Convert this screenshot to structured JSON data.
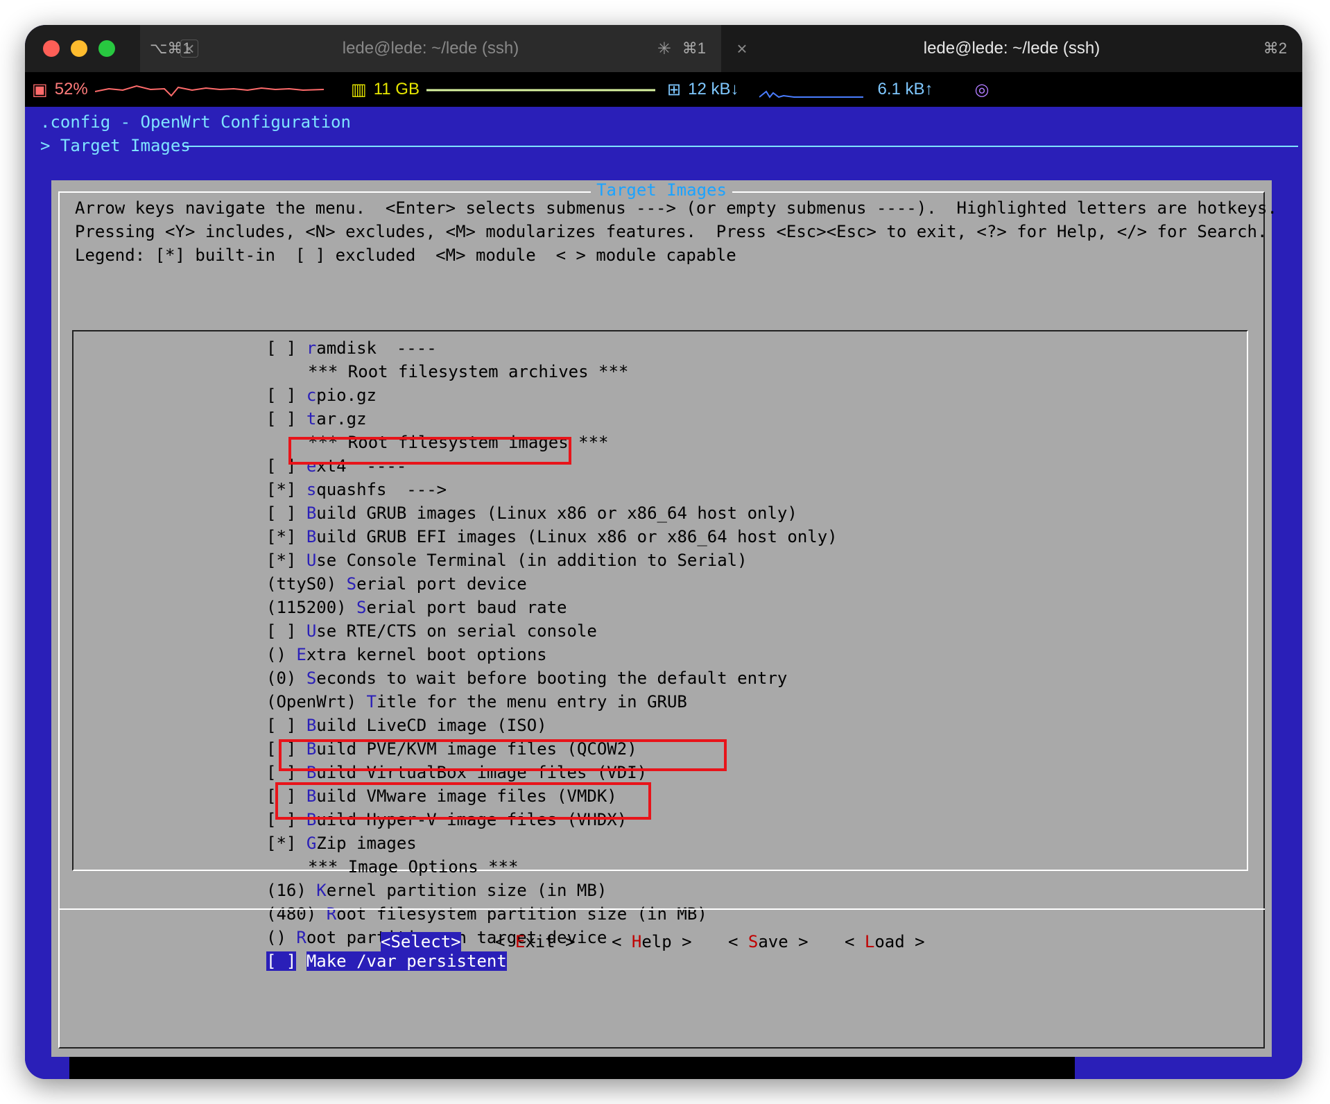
{
  "titlebar": {
    "tab1": {
      "short_left": "⌥⌘1",
      "title": "lede@lede: ~/lede (ssh)",
      "short_right": "⌘1"
    },
    "tab2": {
      "title": "lede@lede: ~/lede (ssh)",
      "short_right": "⌘2"
    }
  },
  "statusbar": {
    "cpu": "52%",
    "mem": "11 GB",
    "down": "12 kB↓",
    "up": "6.1 kB↑"
  },
  "terminal": {
    "header": ".config - OpenWrt Configuration",
    "breadcrumb": "> Target Images"
  },
  "dialog": {
    "title": "Target Images",
    "help": [
      "Arrow keys navigate the menu.  <Enter> selects submenus ---> (or empty submenus ----).  Highlighted letters are hotkeys.",
      "Pressing <Y> includes, <N> excludes, <M> modularizes features.  Press <Esc><Esc> to exit, <?> for Help, </> for Search.",
      "Legend: [*] built-in  [ ] excluded  <M> module  < > module capable"
    ],
    "items": [
      {
        "prefix": "[ ]",
        "hotkey": "r",
        "rest": "amdisk  ----"
      },
      {
        "prefix": "",
        "hotkey": "",
        "rest": "*** Root filesystem archives ***"
      },
      {
        "prefix": "[ ]",
        "hotkey": "c",
        "rest": "pio.gz"
      },
      {
        "prefix": "[ ]",
        "hotkey": "t",
        "rest": "ar.gz"
      },
      {
        "prefix": "",
        "hotkey": "",
        "rest": "*** Root filesystem images ***"
      },
      {
        "prefix": "[ ]",
        "hotkey": "e",
        "rest": "xt4  ----"
      },
      {
        "prefix": "[*]",
        "hotkey": "s",
        "rest": "quashfs  --->"
      },
      {
        "prefix": "[ ]",
        "hotkey": "B",
        "rest": "uild GRUB images (Linux x86 or x86_64 host only)"
      },
      {
        "prefix": "[*]",
        "hotkey": "B",
        "rest": "uild GRUB EFI images (Linux x86 or x86_64 host only)"
      },
      {
        "prefix": "[*]",
        "hotkey": "U",
        "rest": "se Console Terminal (in addition to Serial)"
      },
      {
        "prefix": "(ttyS0)",
        "hotkey": "S",
        "rest": "erial port device"
      },
      {
        "prefix": "(115200)",
        "hotkey": "S",
        "rest": "erial port baud rate"
      },
      {
        "prefix": "[ ]",
        "hotkey": "U",
        "rest": "se RTE/CTS on serial console"
      },
      {
        "prefix": "()",
        "hotkey": "E",
        "rest": "xtra kernel boot options"
      },
      {
        "prefix": "(0)",
        "hotkey": "S",
        "rest": "econds to wait before booting the default entry"
      },
      {
        "prefix": "(OpenWrt)",
        "hotkey": "T",
        "rest": "itle for the menu entry in GRUB"
      },
      {
        "prefix": "[ ]",
        "hotkey": "B",
        "rest": "uild LiveCD image (ISO)"
      },
      {
        "prefix": "[ ]",
        "hotkey": "B",
        "rest": "uild PVE/KVM image files (QCOW2)"
      },
      {
        "prefix": "[ ]",
        "hotkey": "B",
        "rest": "uild VirtualBox image files (VDI)"
      },
      {
        "prefix": "[ ]",
        "hotkey": "B",
        "rest": "uild VMware image files (VMDK)"
      },
      {
        "prefix": "[ ]",
        "hotkey": "B",
        "rest": "uild Hyper-V image files (VHDX)"
      },
      {
        "prefix": "[*]",
        "hotkey": "G",
        "rest": "Zip images"
      },
      {
        "prefix": "",
        "hotkey": "",
        "rest": "*** Image Options ***"
      },
      {
        "prefix": "(16)",
        "hotkey": "K",
        "rest": "ernel partition size (in MB)"
      },
      {
        "prefix": "(480)",
        "hotkey": "R",
        "rest": "oot filesystem partition size (in MB)"
      },
      {
        "prefix": "()",
        "hotkey": "R",
        "rest": "oot partition on target device"
      },
      {
        "prefix": "[ ]",
        "hotkey": "M",
        "rest": "ake /var persistent"
      }
    ],
    "buttons": {
      "select": "<Select>",
      "exit_l": "< ",
      "exit_hk": "E",
      "exit_r": "xit >",
      "help_l": "< ",
      "help_hk": "H",
      "help_r": "elp >",
      "save_l": "< ",
      "save_hk": "S",
      "save_r": "ave >",
      "load_l": "< ",
      "load_hk": "L",
      "load_r": "oad >"
    }
  },
  "colors": {
    "terminal_bg": "#2a1fb8",
    "dialog_bg": "#a9a9a9",
    "hotkey": "#2a1fb8",
    "annotation": "#e8141a"
  }
}
